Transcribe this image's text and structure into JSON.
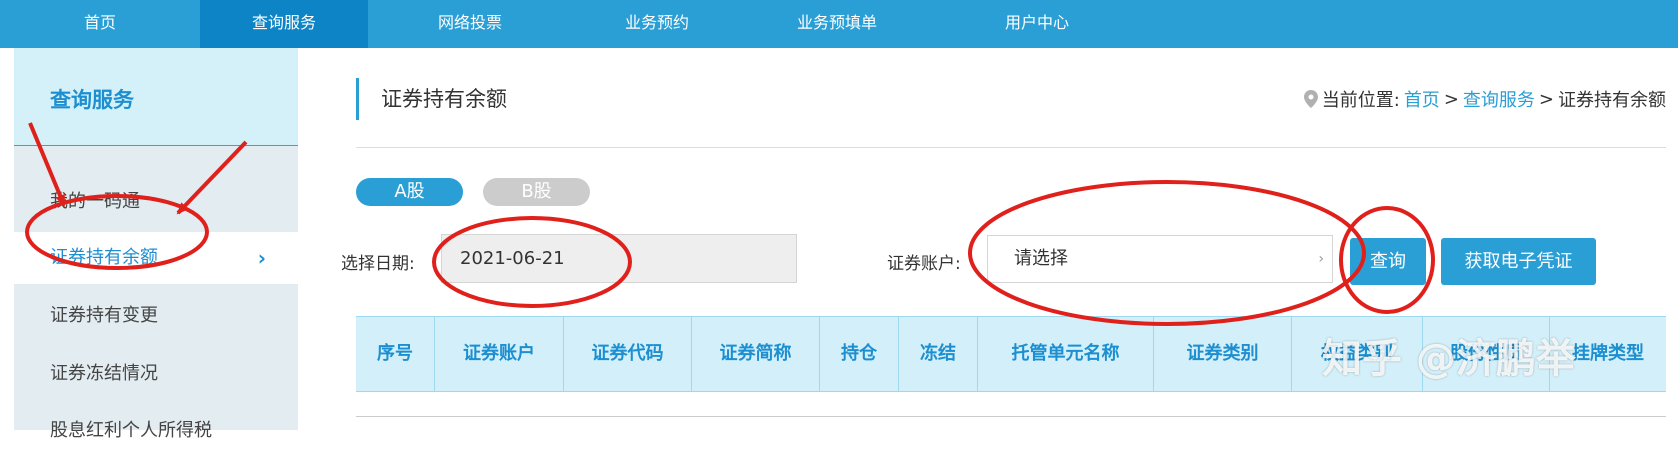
{
  "topnav": {
    "items": [
      {
        "label": "首页"
      },
      {
        "label": "查询服务"
      },
      {
        "label": "网络投票"
      },
      {
        "label": "业务预约"
      },
      {
        "label": "业务预填单"
      },
      {
        "label": "用户中心"
      }
    ]
  },
  "sidebar": {
    "title": "查询服务",
    "items": [
      {
        "label": "我的一码通"
      },
      {
        "label": "证券持有余额"
      },
      {
        "label": "证券持有变更"
      },
      {
        "label": "证券冻结情况"
      },
      {
        "label": "股息红利个人所得税"
      }
    ],
    "chevron": "›"
  },
  "page": {
    "title": "证券持有余额"
  },
  "breadcrumb": {
    "prefix": "当前位置:",
    "home": "首页",
    "section": "查询服务",
    "current": "证券持有余额",
    "sep": ">"
  },
  "tabs": {
    "a": "A股",
    "b": "B股"
  },
  "form": {
    "date_label": "选择日期:",
    "date_value": "2021-06-21",
    "account_label": "证券账户:",
    "account_value": "请选择",
    "query_button": "查询",
    "voucher_button": "获取电子凭证"
  },
  "table": {
    "headers": [
      "序号",
      "证券账户",
      "证券代码",
      "证券简称",
      "持仓",
      "冻结",
      "托管单元名称",
      "证券类别",
      "权益类别",
      "股份性质",
      "挂牌类型"
    ]
  },
  "watermark": "知乎 @济鹏举",
  "colors": {
    "nav": "#2a9fd6",
    "nav_active": "#0d84c6",
    "accent": "#1d8fd0",
    "annotation": "#e0201b"
  }
}
